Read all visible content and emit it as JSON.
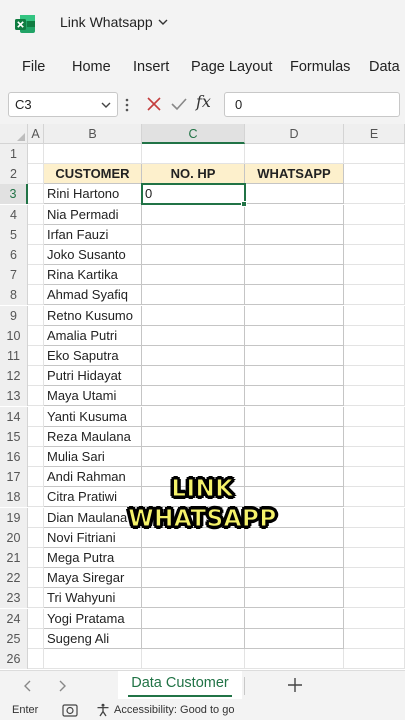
{
  "app": {
    "title": "Link Whatsapp",
    "brand_color": "#217346",
    "logo_icon": "excel-logo-icon"
  },
  "ribbon": {
    "tabs": [
      "File",
      "Home",
      "Insert",
      "Page Layout",
      "Formulas",
      "Data"
    ]
  },
  "formula_bar": {
    "name_box": "C3",
    "value": "0",
    "fx_label": "fx"
  },
  "grid": {
    "columns": [
      "A",
      "B",
      "C",
      "D",
      "E"
    ],
    "active_column": "C",
    "rows": [
      "1",
      "2",
      "3",
      "4",
      "5",
      "6",
      "7",
      "8",
      "9",
      "10",
      "11",
      "12",
      "13",
      "14",
      "15",
      "16",
      "17",
      "18",
      "19",
      "20",
      "21",
      "22",
      "23",
      "24",
      "25",
      "26"
    ],
    "active_row": "3",
    "table_header_color": "#fdf0cc",
    "table": {
      "headers": [
        "CUSTOMER",
        "NO. HP",
        "WHATSAPP"
      ],
      "customers": [
        "Rini Hartono",
        "Nia Permadi",
        "Irfan Fauzi",
        "Joko Susanto",
        "Rina Kartika",
        "Ahmad Syafiq",
        "Retno Kusumo",
        "Amalia Putri",
        "Eko Saputra",
        "Putri Hidayat",
        "Maya Utami",
        "Yanti Kusuma",
        "Reza Maulana",
        "Mulia Sari",
        "Andi Rahman",
        "Citra Pratiwi",
        "Dian Maulana",
        "Novi Fitriani",
        "Mega Putra",
        "Maya Siregar",
        "Tri Wahyuni",
        "Yogi Pratama",
        "Sugeng Ali"
      ],
      "active_cell_value": "0"
    }
  },
  "overlay": {
    "line1": "LINK",
    "line2": "WHATSAPP",
    "color": "#f5f26a"
  },
  "sheet_tabs": {
    "active": "Data Customer"
  },
  "status": {
    "mode": "Enter",
    "accessibility": "Accessibility: Good to go"
  }
}
